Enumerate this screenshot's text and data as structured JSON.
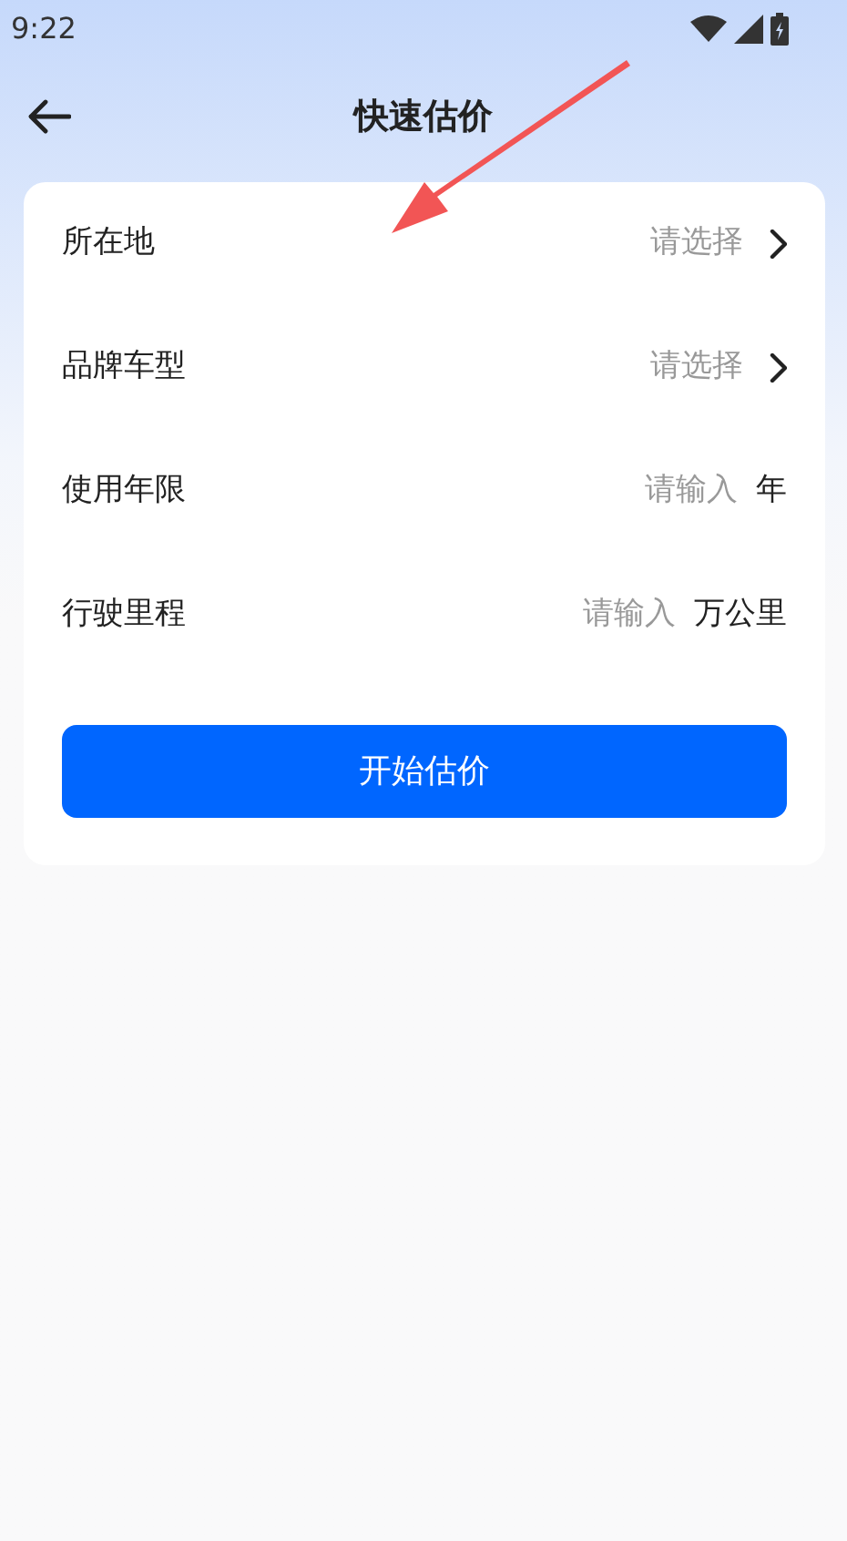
{
  "status_bar": {
    "time": "9:22"
  },
  "header": {
    "title": "快速估价"
  },
  "fields": [
    {
      "kind": "select",
      "label": "所在地",
      "placeholder": "请选择"
    },
    {
      "kind": "select",
      "label": "品牌车型",
      "placeholder": "请选择"
    },
    {
      "kind": "input",
      "label": "使用年限",
      "placeholder": "请输入",
      "unit": "年"
    },
    {
      "kind": "input",
      "label": "行驶里程",
      "placeholder": "请输入",
      "unit": "万公里"
    }
  ],
  "submit_button": {
    "label": "开始估价"
  }
}
